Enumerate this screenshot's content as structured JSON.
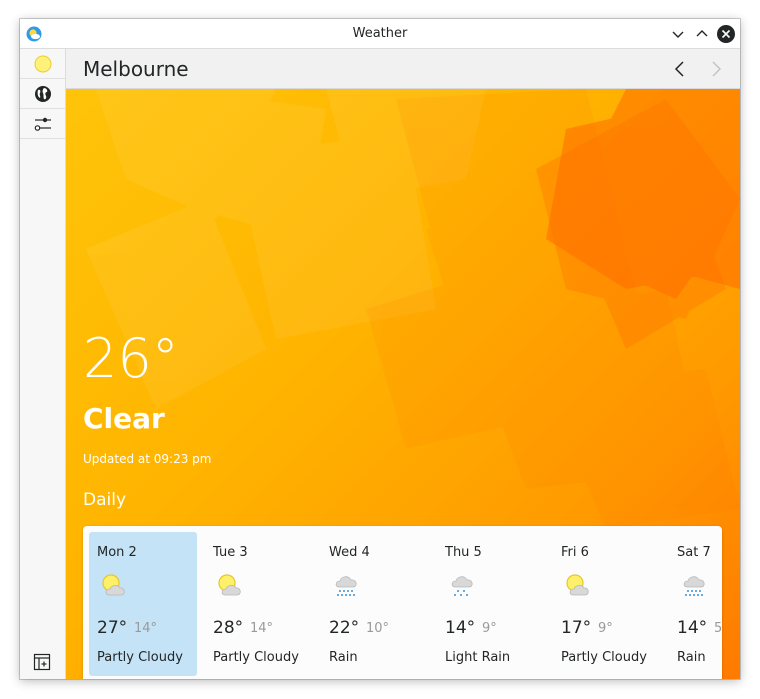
{
  "window": {
    "title": "Weather"
  },
  "colors": {
    "accent_selected": "#c5e3f6",
    "hero_top": "#ffc40a",
    "hero_corner": "#ff7a00"
  },
  "sidebar": {
    "items": [
      {
        "icon": "sun-icon"
      },
      {
        "icon": "globe-icon"
      },
      {
        "icon": "sliders-icon"
      }
    ],
    "bottom_icon": "add-panel-icon"
  },
  "header": {
    "location": "Melbourne"
  },
  "current": {
    "temperature": "26°",
    "condition": "Clear",
    "updated": "Updated at 09:23 pm"
  },
  "daily": {
    "heading": "Daily",
    "days": [
      {
        "name": "Mon 2",
        "high": "27°",
        "low": "14°",
        "description": "Partly Cloudy",
        "icon": "partly-cloudy-icon",
        "selected": true
      },
      {
        "name": "Tue 3",
        "high": "28°",
        "low": "14°",
        "description": "Partly Cloudy",
        "icon": "partly-cloudy-icon",
        "selected": false
      },
      {
        "name": "Wed 4",
        "high": "22°",
        "low": "10°",
        "description": "Rain",
        "icon": "rain-icon",
        "selected": false
      },
      {
        "name": "Thu 5",
        "high": "14°",
        "low": "9°",
        "description": "Light Rain",
        "icon": "light-rain-icon",
        "selected": false
      },
      {
        "name": "Fri 6",
        "high": "17°",
        "low": "9°",
        "description": "Partly Cloudy",
        "icon": "partly-cloudy-icon",
        "selected": false
      },
      {
        "name": "Sat 7",
        "high": "14°",
        "low": "5",
        "description": "Rain",
        "icon": "rain-icon",
        "selected": false
      }
    ]
  }
}
